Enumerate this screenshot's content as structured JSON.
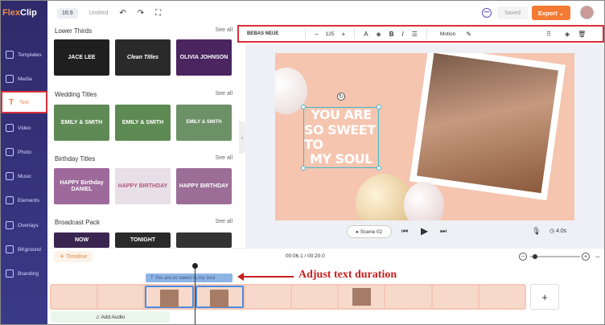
{
  "app": {
    "logo_main": "Flex",
    "logo_accent": "Clip"
  },
  "sidebar": {
    "items": [
      {
        "label": "Templates"
      },
      {
        "label": "Media"
      },
      {
        "label": "Text",
        "active": true
      },
      {
        "label": "Video"
      },
      {
        "label": "Photo"
      },
      {
        "label": "Music"
      },
      {
        "label": "Elements"
      },
      {
        "label": "Overlays"
      },
      {
        "label": "BKground"
      },
      {
        "label": "Branding"
      }
    ]
  },
  "header": {
    "ratio": "16:9",
    "project_name": "Untitled",
    "saved_label": "Saved",
    "export_label": "Export"
  },
  "panel": {
    "see_all": "See all",
    "sections": [
      {
        "title": "Lower Thirds",
        "thumbs": [
          "JACE LEE",
          "Clean Titles",
          "OLIVIA JOHNSON"
        ]
      },
      {
        "title": "Wedding Titles",
        "thumbs": [
          "EMILY & SMITH",
          "EMILY & SMITH",
          "EMILY & SMITH"
        ]
      },
      {
        "title": "Birthday Titles",
        "thumbs": [
          "HAPPY Birthday DANIEL",
          "HAPPY BIRTHDAY",
          "HAPPY BIRTHDAY"
        ]
      },
      {
        "title": "Broadcast Pack",
        "thumbs": [
          "NOW",
          "TONIGHT",
          ""
        ]
      }
    ]
  },
  "text_toolbar": {
    "font": "BEBAS NEUE",
    "size": "125",
    "motion_label": "Motion"
  },
  "canvas": {
    "text_lines": [
      "YOU ARE",
      "SO SWEET TO",
      "MY SOUL"
    ]
  },
  "player": {
    "scene_label": "Scene 02",
    "duration": "4.0s"
  },
  "timeline": {
    "button_label": "Timeline",
    "time_readout": "00:06.1 / 00:20.0",
    "text_clip": "You are,so sweet to,my soul",
    "add_audio": "Add Audio",
    "add_scene": "+"
  },
  "annotation": {
    "text": "Adjust text duration",
    "color": "#c81e1e"
  },
  "colors": {
    "accent": "#f37b33",
    "sidebar": "#2e2a6b",
    "highlight_box": "#d9303a"
  }
}
